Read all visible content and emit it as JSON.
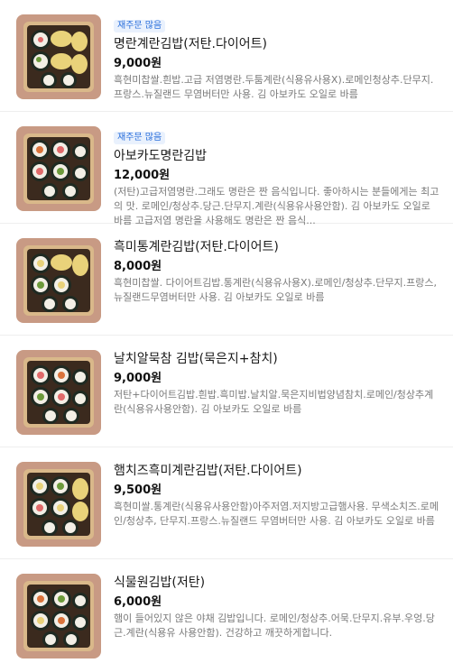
{
  "menu": {
    "items": [
      {
        "badge": "재주문 많음",
        "name": "명란계란김밥(저탄.다이어트)",
        "price": "9,000원",
        "description": "흑현미찹쌀.흰밥.고급 저염명란.두툼계란(식용유사용X).로메인청상추.단무지.프랑스.뉴질랜드 무염버터만 사용. 김 아보카도 오일로 바름"
      },
      {
        "badge": "재주문 많음",
        "name": "아보카도명란김밥",
        "price": "12,000원",
        "description": "(저탄)고급저염명란.그래도 명란은 짠 음식입니다. 좋아하시는 분들에게는 최고의 맛. 로메인/청상추.당근.단무지.계란(식용유사용안함). 김 아보카도 오일로 바름 고급저염 명란을 사용해도 명란은 짠 음식..."
      },
      {
        "badge": "",
        "name": "흑미통계란김밥(저탄.다이어트)",
        "price": "8,000원",
        "description": "흑현미찹쌀. 다이어트김밥.통계란(식용유사용X).로메인/청상추.단무지.프랑스,뉴질랜드무염버터만 사용. 김 아보카도 오일로 바름"
      },
      {
        "badge": "",
        "name": "날치알묵참 김밥(묵은지+참치)",
        "price": "9,000원",
        "description": "저탄+다이어트김밥.흰밥.흑미밥.날치알.묵은지비법양념참치.로메인/청상추계란(식용유사용안함). 김 아보카도 오일로 바름"
      },
      {
        "badge": "",
        "name": "햄치즈흑미계란김밥(저탄.다이어트)",
        "price": "9,500원",
        "description": "흑현미쌀.통계란(식용유사용안함)아주저염.저지방고급햄사용. 무색소치즈.로메인/청상추, 단무지.프랑스.뉴질랜드 무염버터만 사용. 김 아보카도 오일로 바름"
      },
      {
        "badge": "",
        "name": "식물원김밥(저탄)",
        "price": "6,000원",
        "description": "햄이 들어있지 않은 야채 김밥입니다. 로메인/청상추.어묵.단무지.유부.우엉.당근.계란(식용유 사용안함). 건강하고 깨끗하게합니다."
      }
    ]
  },
  "colors": {
    "badge_text": "#2a6fdb",
    "badge_bg": "#e9f1fd",
    "description": "#7a7a7a",
    "divider": "#eeeeee",
    "thumb_background": "#c89a84",
    "tray": "#d9b88a",
    "seaweed": "#1f2a22",
    "rice": "#f3efe6",
    "egg": "#e9d27a",
    "carrot": "#d9733b",
    "greens": "#6c9a3b"
  }
}
